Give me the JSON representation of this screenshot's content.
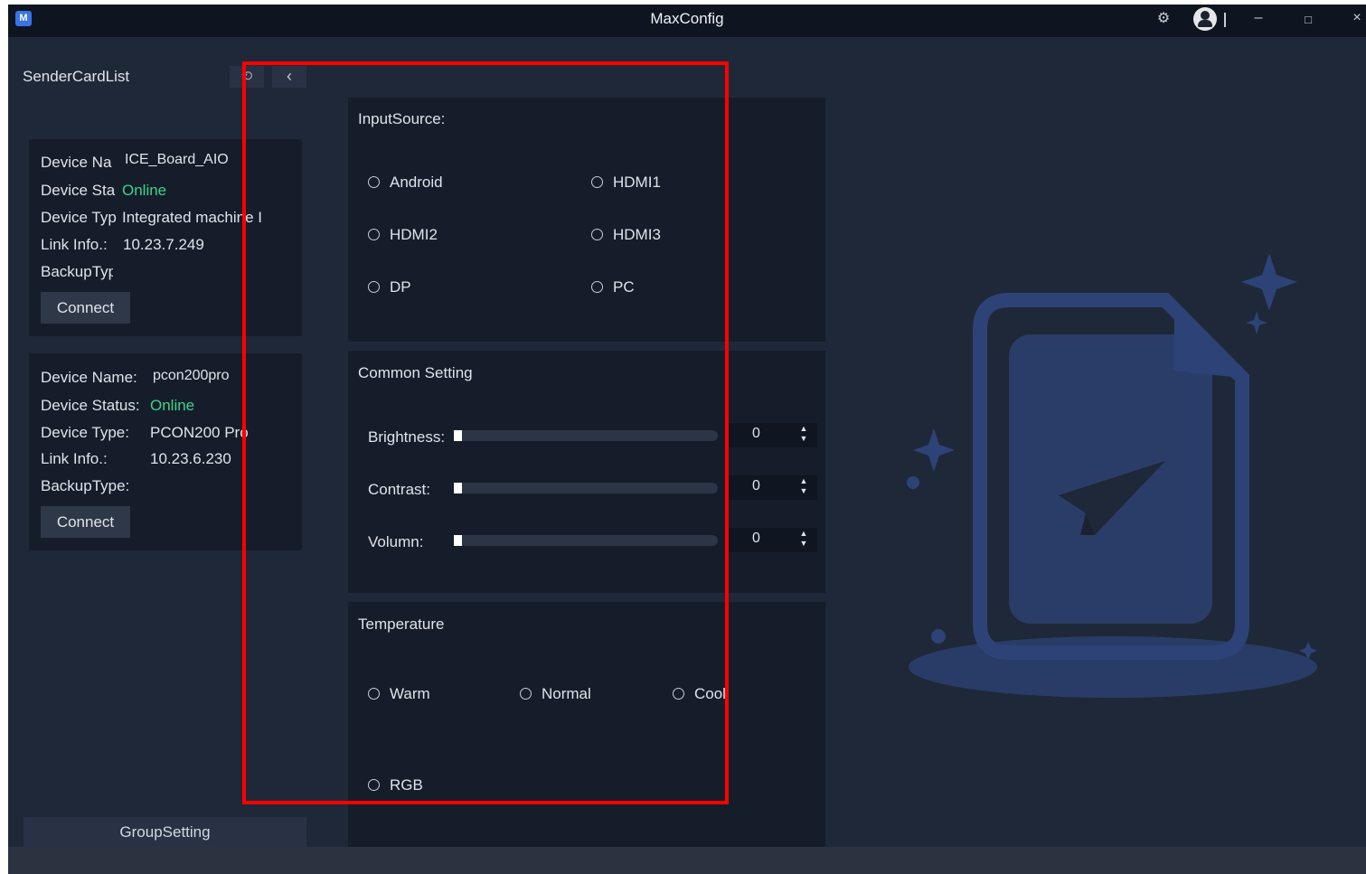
{
  "window": {
    "app_logo": "M",
    "title": "MaxConfig",
    "icons": {
      "settings": "gear-icon",
      "avatar": "user-avatar-icon",
      "minimize": "minimize-icon",
      "maximize": "maximize-icon",
      "close": "close-icon"
    },
    "glyphs": {
      "settings": "⚙",
      "minimize": "–",
      "maximize": "□",
      "close": "×"
    }
  },
  "sidebar": {
    "title": "SenderCardList",
    "refresh_icon": "refresh-icon",
    "refresh_glyph": "⟲",
    "collapse_icon": "chevron-left-icon",
    "collapse_glyph": "‹",
    "cards": [
      {
        "labels": [
          "Device Na",
          "Device Sta",
          "Device Typ",
          "Link Info.:",
          "BackupTyp"
        ],
        "values": [
          "ICE_Board_AIO",
          "Online",
          "Integrated machine I",
          "10.23.7.249",
          ""
        ],
        "connect_label": "Connect"
      },
      {
        "labels": [
          "Device Name:",
          "Device Status:",
          "Device Type:",
          "Link Info.:",
          "BackupType:"
        ],
        "values": [
          "pcon200pro",
          "Online",
          "PCON200 Pro",
          "10.23.6.230",
          ""
        ],
        "connect_label": "Connect"
      }
    ],
    "group_setting_label": "GroupSetting"
  },
  "input_source": {
    "heading": "InputSource:",
    "options": [
      "Android",
      "HDMI1",
      "HDMI2",
      "HDMI3",
      "DP",
      "PC"
    ]
  },
  "common_setting": {
    "heading": "Common Setting",
    "sliders": [
      {
        "label": "Brightness:",
        "value": 0
      },
      {
        "label": "Contrast:",
        "value": 0
      },
      {
        "label": "Volumn:",
        "value": 0
      }
    ],
    "spin_up": "▲",
    "spin_down": "▼"
  },
  "temperature": {
    "heading": "Temperature",
    "options": [
      "Warm",
      "Normal",
      "Cool",
      "RGB"
    ]
  },
  "illustration_icon": "empty-file-paper-plane-icon",
  "colors": {
    "background": "#1f2838",
    "panel": "#151d2a",
    "titlebar": "#0e1520",
    "online": "#3fd18a",
    "accent": "#3a73e8",
    "illustration": "#2d4377",
    "highlight": "#ff0000"
  }
}
